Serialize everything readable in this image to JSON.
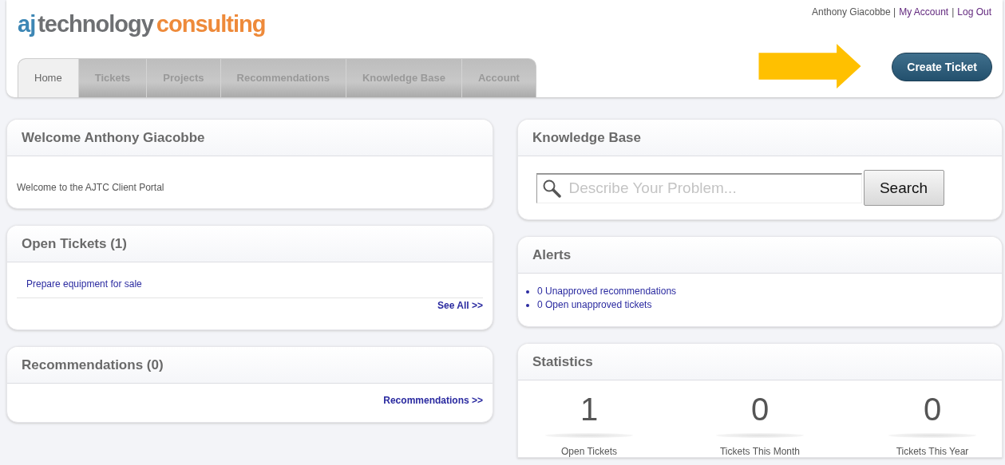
{
  "logo": {
    "mark": "aj",
    "word1": "technology",
    "word2": "consulting"
  },
  "user_bar": {
    "name": "Anthony Giacobbe",
    "separator": "|",
    "links": [
      {
        "label": "My Account",
        "visited": true
      },
      {
        "label": "Log Out",
        "visited": true
      }
    ]
  },
  "tabs": [
    {
      "label": "Home",
      "selected": true
    },
    {
      "label": "Tickets",
      "selected": false
    },
    {
      "label": "Projects",
      "selected": false
    },
    {
      "label": "Recommendations",
      "selected": false
    },
    {
      "label": "Knowledge Base",
      "selected": false
    },
    {
      "label": "Account",
      "selected": false
    }
  ],
  "create_button": {
    "label": "Create Ticket"
  },
  "welcome": {
    "title": "Welcome Anthony Giacobbe",
    "text": "Welcome to the AJTC Client Portal"
  },
  "open_tickets": {
    "title": "Open Tickets (1)",
    "items": [
      "Prepare equipment for sale"
    ],
    "more": "See All >>"
  },
  "recommendations": {
    "title": "Recommendations (0)",
    "more": "Recommendations >>"
  },
  "knowledge_base": {
    "title": "Knowledge Base",
    "placeholder": "Describe Your Problem...",
    "button": "Search"
  },
  "alerts": {
    "title": "Alerts",
    "items": [
      "0 Unapproved recommendations",
      "0 Open unapproved tickets"
    ]
  },
  "statistics": {
    "title": "Statistics",
    "items": [
      {
        "value": "1",
        "label": "Open Tickets"
      },
      {
        "value": "0",
        "label": "Tickets This Month"
      },
      {
        "value": "0",
        "label": "Tickets This Year"
      }
    ]
  }
}
